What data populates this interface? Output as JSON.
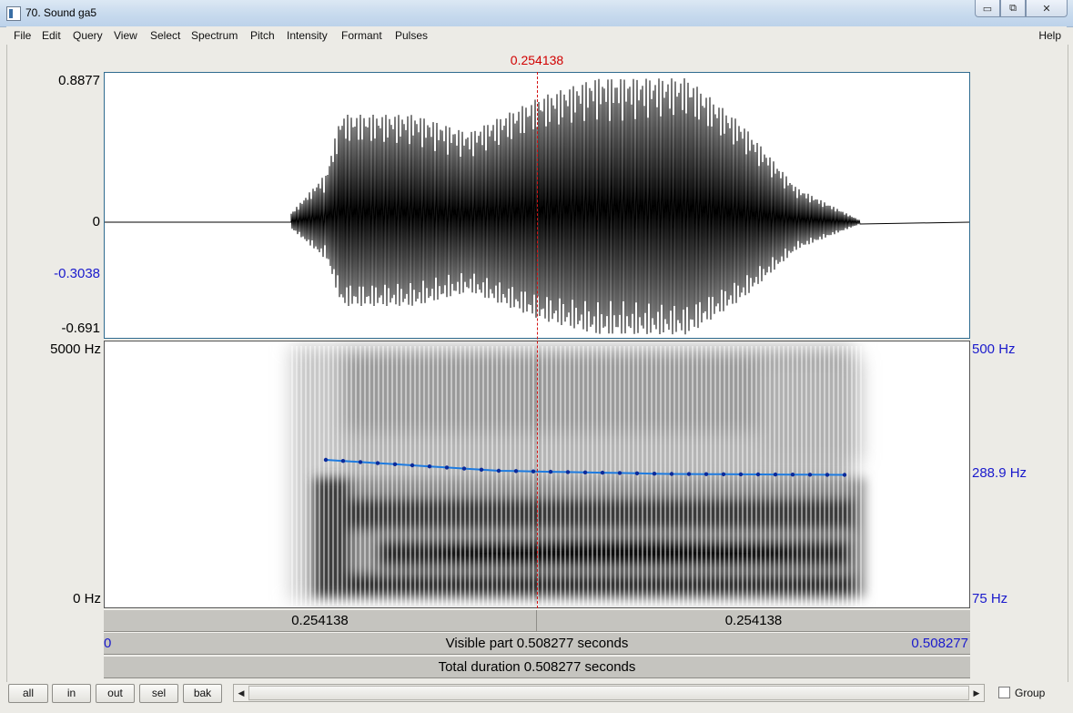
{
  "window": {
    "title": "70. Sound ga5",
    "minimize": "▭",
    "restore": "⧉",
    "close": "✕"
  },
  "menu": [
    "File",
    "Edit",
    "Query",
    "View",
    "Select",
    "Spectrum",
    "Pitch",
    "Intensity",
    "Formant",
    "Pulses"
  ],
  "menu_help": "Help",
  "cursor_time": "0.254138",
  "waveform": {
    "ymax": "0.8877",
    "zero": "0",
    "cursor_value": "-0.3038",
    "ymin": "-0.691"
  },
  "spectrogram": {
    "top": "5000 Hz",
    "bottom": "0 Hz"
  },
  "pitch": {
    "top": "500 Hz",
    "current": "288.9 Hz",
    "bottom": "75 Hz"
  },
  "bar_cursor": {
    "left": "0.254138",
    "right": "0.254138"
  },
  "visible": {
    "start": "0",
    "label": "Visible part 0.508277 seconds",
    "end": "0.508277"
  },
  "total": {
    "label": "Total duration 0.508277 seconds"
  },
  "buttons": {
    "all": "all",
    "in": "in",
    "out": "out",
    "sel": "sel",
    "bak": "bak"
  },
  "scroll_left": "◀",
  "scroll_right": "▶",
  "group_label": "Group",
  "colors": {
    "cursor": "#d10000",
    "pitch_line": "#1e7be0",
    "pitch_points": "#0b2a9a",
    "label_blue": "#1a1acc"
  }
}
